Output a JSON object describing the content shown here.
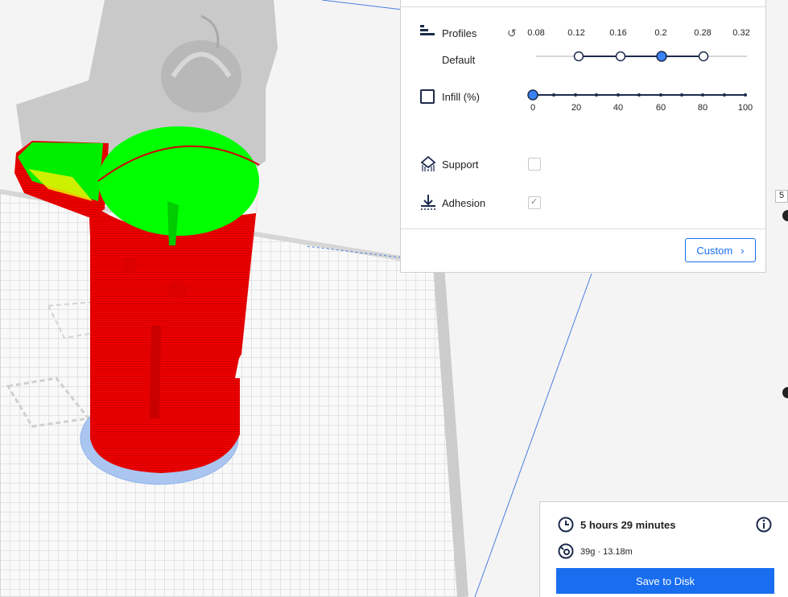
{
  "print_settings": {
    "profiles_label": "Profiles",
    "profile_name": "Default",
    "layer_heights": [
      "0.08",
      "0.12",
      "0.16",
      "0.2",
      "0.28",
      "0.32"
    ],
    "selected_layer_height": "0.2",
    "infill_label": "Infill (%)",
    "infill_ticks": [
      "0",
      "20",
      "40",
      "60",
      "80",
      "100"
    ],
    "infill_value_percent": 0,
    "support_label": "Support",
    "support_checked": false,
    "adhesion_label": "Adhesion",
    "adhesion_checked": true,
    "custom_button": "Custom"
  },
  "summary": {
    "print_time": "5 hours 29 minutes",
    "material": "39g · 13.18m",
    "save_button": "Save to Disk"
  },
  "edge_field_value": "5",
  "colors": {
    "accent": "#196ef0",
    "model_walls": "#ff0000",
    "model_top": "#00ff00",
    "brim": "#a9c4f0",
    "build_plate": "#f7f7f7",
    "grid": "#c8c8c8"
  },
  "icons": {
    "profiles": "profiles-icon",
    "reset": "reset-icon",
    "infill": "infill-icon",
    "support": "support-icon",
    "adhesion": "adhesion-icon",
    "clock": "clock-icon",
    "info": "info-icon",
    "spool": "spool-icon",
    "chevron": "chevron-right-icon"
  }
}
